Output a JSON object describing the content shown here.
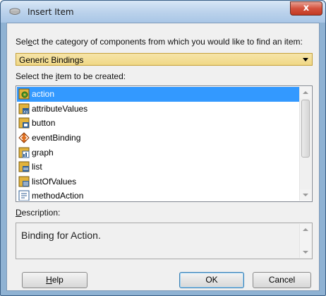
{
  "window": {
    "title": "Insert Item",
    "close_label": "x"
  },
  "category": {
    "prompt_pre": "Sel",
    "prompt_u": "e",
    "prompt_post": "ct the category of components from which you would like to find an item:",
    "selected": "Generic Bindings"
  },
  "items_section": {
    "prompt_pre": "Select the ",
    "prompt_u": "i",
    "prompt_post": "tem to be created:",
    "items": [
      {
        "label": "action",
        "icon": "action-binding-icon",
        "selected": true
      },
      {
        "label": "attributeValues",
        "icon": "attribute-values-icon",
        "selected": false
      },
      {
        "label": "button",
        "icon": "button-binding-icon",
        "selected": false
      },
      {
        "label": "eventBinding",
        "icon": "event-binding-icon",
        "selected": false
      },
      {
        "label": "graph",
        "icon": "graph-icon",
        "selected": false
      },
      {
        "label": "list",
        "icon": "list-binding-icon",
        "selected": false
      },
      {
        "label": "listOfValues",
        "icon": "list-of-values-icon",
        "selected": false
      },
      {
        "label": "methodAction",
        "icon": "method-action-icon",
        "selected": false
      }
    ]
  },
  "description": {
    "label_u": "D",
    "label_post": "escription:",
    "text": "Binding for Action."
  },
  "buttons": {
    "help_u": "H",
    "help_post": "elp",
    "ok": "OK",
    "cancel": "Cancel"
  },
  "colors": {
    "selection": "#3399ff",
    "combo_bg": "#f0d886",
    "frame": "#8fb2d3"
  }
}
